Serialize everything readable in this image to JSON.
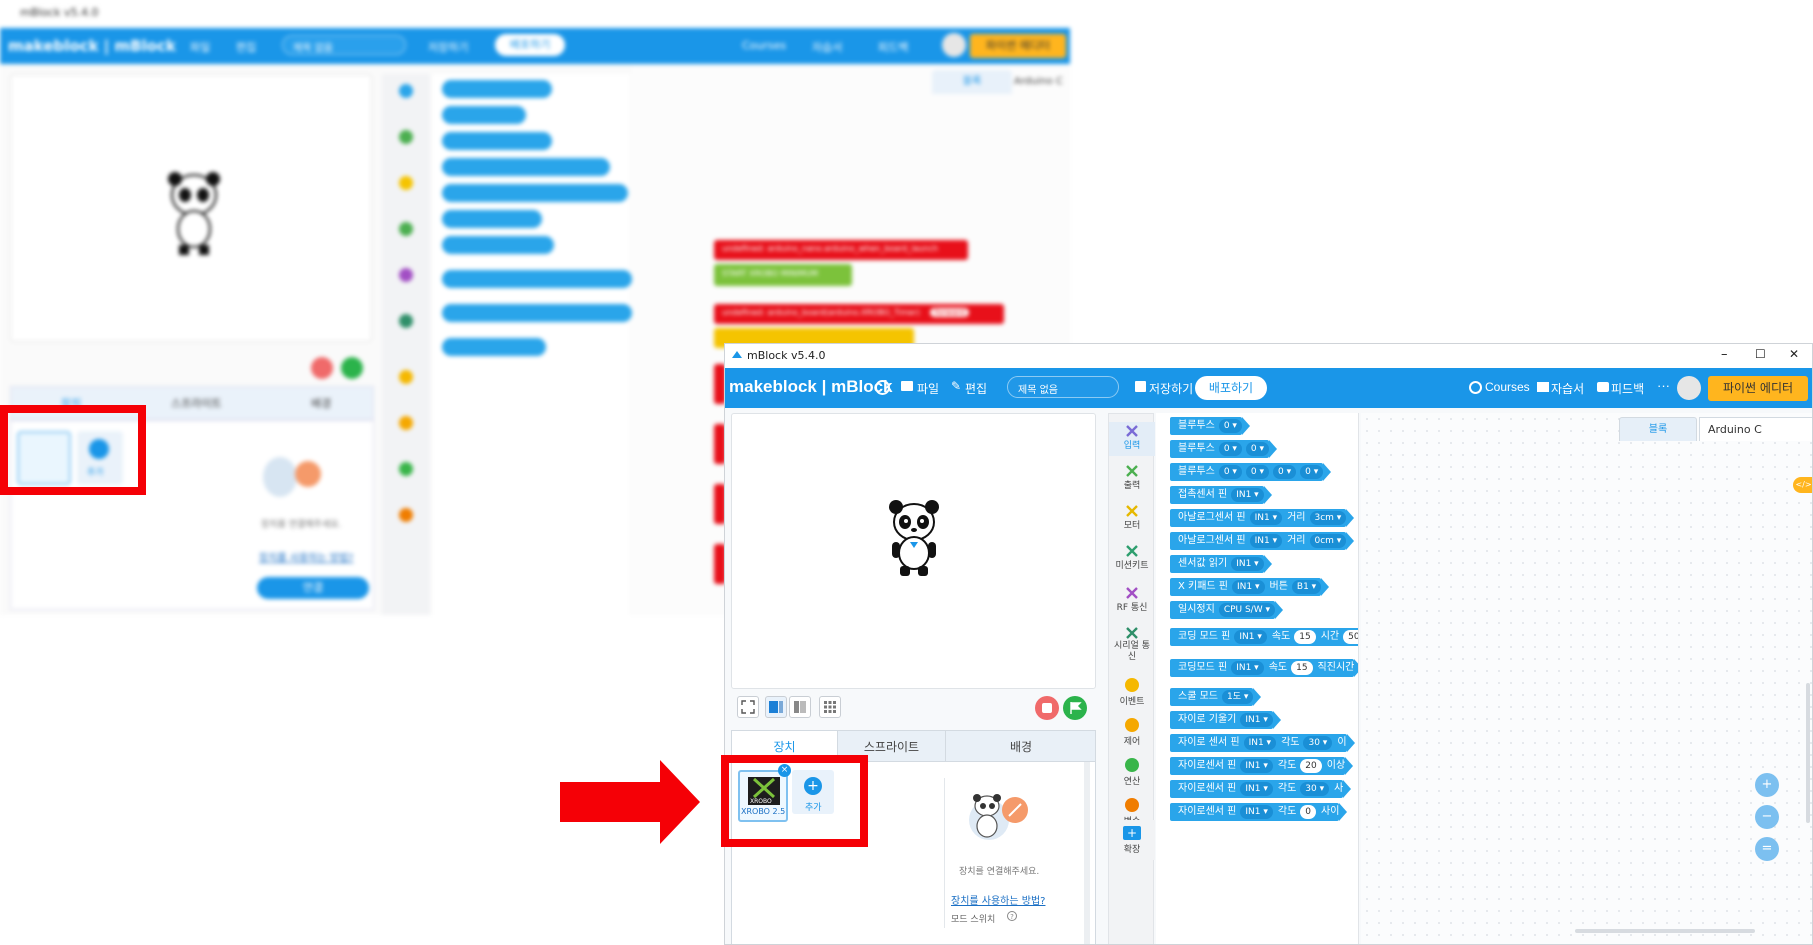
{
  "background_window": {
    "title": "mBlock v5.4.0",
    "menu": [
      "makeblock | mBlock",
      "파일",
      "편집",
      "제목 없음",
      "저장하기",
      "배포하기",
      "Courses",
      "자습서",
      "피드백",
      "파이썬 에디터"
    ],
    "tabs": [
      "장치",
      "스프라이트",
      "배경"
    ],
    "add_label": "추가",
    "device_hint": "장치를 연결해주세요.",
    "device_link": "장치를 사용하는 방법?",
    "connect_button": "연결",
    "right_tabs": [
      "블록",
      "Arduino C"
    ],
    "code_red_1": "undefined: arduino_nano.arduino_when_board_launch",
    "code_green": "START XROBO  MINIMUM",
    "code_red_2": "undefined: arduino_board(arduino.XROBO_Timer)",
    "code_red_pill": "forward"
  },
  "window": {
    "title": "mBlock v5.4.0",
    "controls": [
      "–",
      "☐",
      "✕"
    ]
  },
  "menubar": {
    "logo": "makeblock | mBlock",
    "file": "파일",
    "edit": "편집",
    "project_name": "제목 없음",
    "save": "저장하기",
    "publish": "배포하기",
    "courses": "Courses",
    "tutorial": "자습서",
    "feedback": "피드백",
    "more": "···",
    "python_editor": "파이썬 에디터"
  },
  "tabs": {
    "device": "장치",
    "sprite": "스프라이트",
    "background": "배경"
  },
  "device": {
    "name": "XROBO 2.5",
    "logo_text": "XROBO",
    "add_label": "추가",
    "hint": "장치를 연결해주세요.",
    "link": "장치를 사용하는 방법?",
    "mode_switch": "모드 스위치"
  },
  "categories": [
    {
      "label": "입력",
      "color": "#7a6bd6"
    },
    {
      "label": "출력",
      "color": "#4caf50"
    },
    {
      "label": "모터",
      "color": "#e6b800"
    },
    {
      "label": "미션키트",
      "color": "#2e9e6e"
    },
    {
      "label": "RF 통신",
      "color": "#a24fc4"
    },
    {
      "label": "시리얼 통신",
      "color": "#2f8f69"
    },
    {
      "label": "이벤트",
      "color": "#f5b800"
    },
    {
      "label": "제어",
      "color": "#f5a800"
    },
    {
      "label": "연산",
      "color": "#39b54a"
    },
    {
      "label": "변수",
      "color": "#f07d00"
    }
  ],
  "extension_label": "확장",
  "blocks": [
    {
      "text": "블루투스",
      "params": [
        "0 ▾"
      ]
    },
    {
      "text": "블루투스",
      "params": [
        "0 ▾",
        "0 ▾"
      ]
    },
    {
      "text": "블루투스",
      "params": [
        "0 ▾",
        "0 ▾",
        "0 ▾",
        "0 ▾"
      ]
    },
    {
      "text": "접촉센서 핀",
      "params": [
        "IN1 ▾"
      ]
    },
    {
      "text": "아날로그센서 핀",
      "params": [
        "IN1 ▾",
        "거리",
        "3cm ▾"
      ]
    },
    {
      "text": "아날로그센서 핀",
      "params": [
        "IN1 ▾",
        "거리",
        "0cm ▾"
      ]
    },
    {
      "text": "센서값 읽기",
      "params": [
        "IN1 ▾"
      ]
    },
    {
      "text": "X 키패드 핀",
      "params": [
        "IN1 ▾",
        "버튼",
        "B1 ▾"
      ]
    },
    {
      "text": "일시정지",
      "params": [
        "CPU S/W ▾"
      ]
    },
    {
      "text": "코딩 모드 핀",
      "params": [
        "IN1 ▾",
        "속도",
        "15",
        "시간",
        "50"
      ]
    },
    {
      "text": "코딩모드 핀",
      "params": [
        "IN1 ▾",
        "속도",
        "15",
        "직진시간"
      ]
    },
    {
      "text": "스쿨 모드",
      "params": [
        "1도 ▾"
      ]
    },
    {
      "text": "자이로 기울기",
      "params": [
        "IN1 ▾"
      ]
    },
    {
      "text": "자이로 센서 핀",
      "params": [
        "IN1 ▾",
        "각도",
        "30 ▾",
        "이"
      ]
    },
    {
      "text": "자이로센서 핀",
      "params": [
        "IN1 ▾",
        "각도",
        "20",
        "이상"
      ]
    },
    {
      "text": "자이로센서 핀",
      "params": [
        "IN1 ▾",
        "각도",
        "30 ▾",
        "사"
      ]
    },
    {
      "text": "자이로센서 핀",
      "params": [
        "IN1 ▾",
        "각도",
        "0",
        "사이"
      ]
    }
  ],
  "right_tabs": {
    "blocks": "블록",
    "arduino": "Arduino C"
  },
  "code_toggle": "</>",
  "zoom": [
    "+",
    "−",
    "="
  ],
  "colors": {
    "brand_blue": "#1a96e8",
    "python_orange": "#ffb51e",
    "annotation_red": "#f50006",
    "block_blue": "#2aa5ea"
  }
}
